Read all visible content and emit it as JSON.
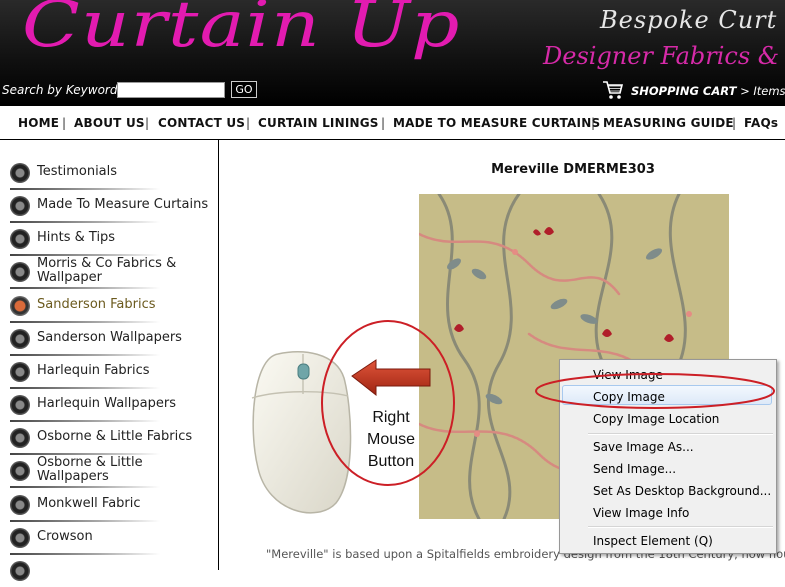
{
  "header": {
    "brand": "Curtain Up",
    "tagline_1": "Bespoke Curt",
    "tagline_2": "Designer Fabrics &",
    "search_label": "Search by Keyword",
    "search_value": "",
    "go_label": "GO",
    "cart_label": "SHOPPING CART",
    "cart_items": "> Items"
  },
  "nav": {
    "items": [
      "HOME",
      "ABOUT US",
      "CONTACT US",
      "CURTAIN LININGS",
      "MADE TO MEASURE CURTAINS",
      "MEASURING GUIDE",
      "FAQs"
    ],
    "separator": "|"
  },
  "sidebar": {
    "items": [
      {
        "label": "Testimonials"
      },
      {
        "label": "Made To Measure Curtains"
      },
      {
        "label": "Hints & Tips"
      },
      {
        "label": "Morris & Co Fabrics & Wallpaper"
      },
      {
        "label": "Sanderson Fabrics",
        "active": true
      },
      {
        "label": "Sanderson Wallpapers"
      },
      {
        "label": "Harlequin Fabrics"
      },
      {
        "label": "Harlequin Wallpapers"
      },
      {
        "label": "Osborne & Little Fabrics"
      },
      {
        "label": "Osborne & Little Wallpapers"
      },
      {
        "label": "Monkwell Fabric"
      },
      {
        "label": "Crowson"
      }
    ]
  },
  "product": {
    "title": "Mereville DMERME303",
    "description": "\"Mereville\" is based upon a Spitalfields embroidery design from the 18th Century, now hou"
  },
  "annotation": {
    "mouse_caption_1": "Right",
    "mouse_caption_2": "Mouse",
    "mouse_caption_3": "Button",
    "ring_color": "#cc1f26"
  },
  "context_menu": {
    "items": [
      {
        "label": "View Image"
      },
      {
        "label": "Copy Image",
        "highlighted": true
      },
      {
        "label": "Copy Image Location"
      },
      {
        "label": "Save Image As..."
      },
      {
        "label": "Send Image..."
      },
      {
        "label": "Set As Desktop Background..."
      },
      {
        "label": "View Image Info"
      },
      {
        "label": "Inspect Element (Q)"
      }
    ]
  },
  "colors": {
    "brand_pink": "#e21bb0",
    "fabric_bg": "#c8bf8a",
    "arrow_red": "#c0341c"
  }
}
